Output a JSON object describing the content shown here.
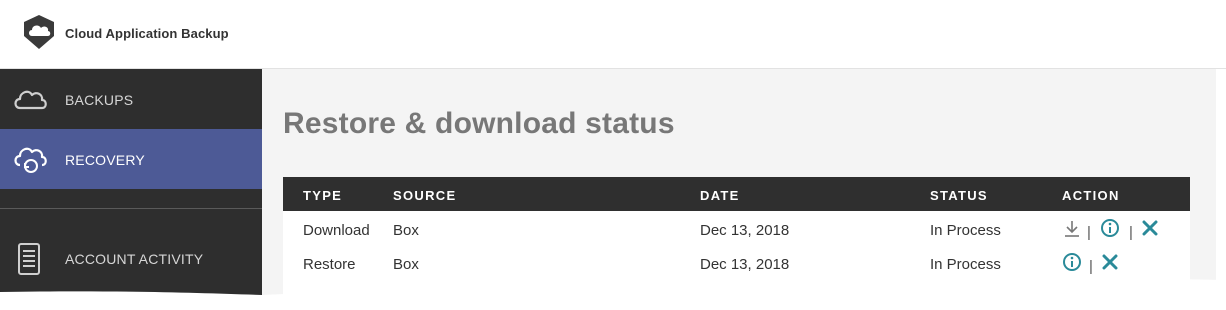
{
  "app": {
    "title": "Cloud Application Backup"
  },
  "sidebar": {
    "items": [
      {
        "label": "BACKUPS",
        "icon": "cloud-icon",
        "active": false
      },
      {
        "label": "RECOVERY",
        "icon": "cloud-sync-icon",
        "active": true
      },
      {
        "label": "ACCOUNT ACTIVITY",
        "icon": "document-list-icon",
        "active": false
      }
    ]
  },
  "main": {
    "title": "Restore & download status",
    "table": {
      "headers": [
        "TYPE",
        "SOURCE",
        "DATE",
        "STATUS",
        "ACTION"
      ],
      "rows": [
        {
          "type": "Download",
          "source": "Box",
          "date": "Dec 13, 2018",
          "status": "In Process",
          "actions": [
            "download-icon",
            "info-icon",
            "cancel-icon"
          ]
        },
        {
          "type": "Restore",
          "source": "Box",
          "date": "Dec 13, 2018",
          "status": "In Process",
          "actions": [
            "info-icon",
            "cancel-icon"
          ]
        }
      ],
      "separator": "|"
    }
  },
  "colors": {
    "sidebar_bg": "#2e2e2e",
    "active_item": "#4d5a96",
    "table_header": "#2f2f2f",
    "action_teal": "#2a8a99",
    "title_gray": "#777777"
  }
}
